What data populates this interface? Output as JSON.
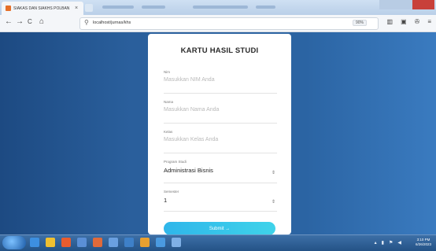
{
  "browser": {
    "tab_title": "SIAKAS DAN SIAKHS POLBAN",
    "tab_close": "×",
    "new_tab": "+",
    "back": "←",
    "forward": "→",
    "reload": "C",
    "home": "⌂",
    "url": "localhost/jurnas/khs",
    "zoom": "90%",
    "tool_icons": [
      "library-icon",
      "sidebar-icon",
      "extensions-icon",
      "menu-icon"
    ]
  },
  "form": {
    "title": "KARTU HASIL STUDI",
    "nim_label": "Nim",
    "nim_placeholder": "Masukkan NIM Anda",
    "nama_label": "Nama",
    "nama_placeholder": "Masukkan Nama Anda",
    "kelas_label": "Kelas",
    "kelas_placeholder": "Masukkan Kelas Anda",
    "prodi_label": "Program Studi",
    "prodi_value": "Administrasi Bisnis",
    "semester_label": "Semester",
    "semester_value": "1",
    "submit_label": "Submit →"
  },
  "taskbar": {
    "time": "3:10 PM",
    "date": "6/26/2023"
  },
  "colors": {
    "background_gradient": "#2b64a3",
    "submit_button": "#2fb6ea"
  }
}
